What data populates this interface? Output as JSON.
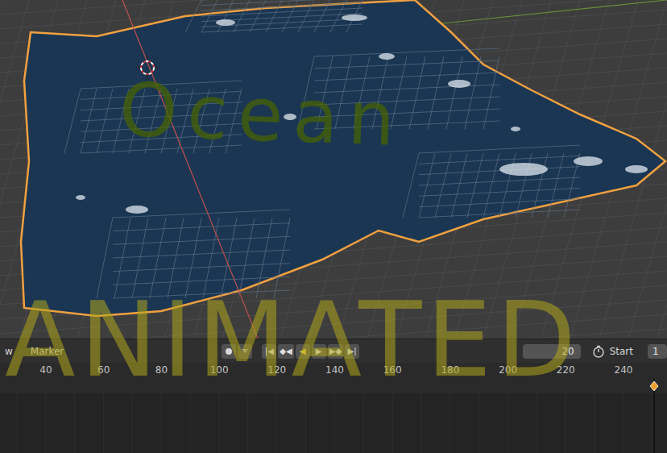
{
  "viewport": {
    "overlay_text": "Ocean"
  },
  "overlay_caption": "ANIMATED",
  "timeline": {
    "menus": [
      "w",
      "Marker"
    ],
    "record_selected": false,
    "playback_buttons": [
      {
        "label": "|◀",
        "selected": false
      },
      {
        "label": "◆◀",
        "selected": false
      },
      {
        "label": "◀",
        "selected": true
      },
      {
        "label": "▶",
        "selected": false
      },
      {
        "label": "▶◆",
        "selected": false
      },
      {
        "label": "▶|",
        "selected": false
      }
    ],
    "current_frame": "20",
    "start_label": "Start",
    "start_value": "1",
    "ruler": [
      "40",
      "60",
      "80",
      "100",
      "120",
      "140",
      "160",
      "180",
      "200",
      "220",
      "240"
    ]
  }
}
